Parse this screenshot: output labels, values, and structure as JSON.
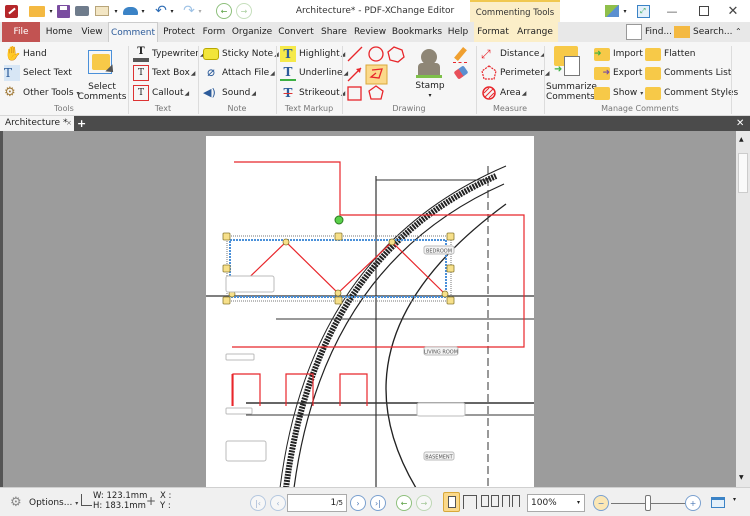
{
  "window": {
    "title": "Architecture* - PDF-XChange Editor",
    "context_tab": "Commenting Tools"
  },
  "menu": {
    "file": "File",
    "items": [
      "Home",
      "View",
      "Comment",
      "Protect",
      "Form",
      "Organize",
      "Convert",
      "Share",
      "Review",
      "Bookmarks",
      "Help"
    ],
    "context_items": [
      "Format",
      "Arrange"
    ],
    "find": "Find...",
    "search": "Search..."
  },
  "ribbon": {
    "tools": {
      "label": "Tools",
      "hand": "Hand",
      "select_text": "Select Text",
      "other_tools": "Other Tools"
    },
    "select_comments": {
      "line1": "Select",
      "line2": "Comments"
    },
    "text": {
      "label": "Text",
      "typewriter": "Typewriter",
      "text_box": "Text Box",
      "callout": "Callout"
    },
    "note": {
      "label": "Note",
      "sticky_note": "Sticky Note",
      "attach_file": "Attach File",
      "sound": "Sound"
    },
    "markup": {
      "label": "Text Markup",
      "highlight": "Highlight",
      "underline": "Underline",
      "strikeout": "Strikeout"
    },
    "drawing": {
      "label": "Drawing",
      "stamp": "Stamp"
    },
    "measure": {
      "label": "Measure",
      "distance": "Distance",
      "perimeter": "Perimeter",
      "area": "Area"
    },
    "summarize": {
      "line1": "Summarize",
      "line2": "Comments"
    },
    "manage": {
      "label": "Manage Comments",
      "import": "Import",
      "export": "Export",
      "show": "Show",
      "flatten": "Flatten",
      "comments_list": "Comments List",
      "comment_styles": "Comment Styles"
    }
  },
  "document_tab": {
    "name": "Architecture *"
  },
  "drawing_labels": {
    "bedroom": "BEDROOM",
    "living_room": "LIVING ROOM",
    "basement": "BASEMENT"
  },
  "statusbar": {
    "options": "Options...",
    "width": "W: 123.1mm",
    "height": "H: 183.1mm",
    "x": "X :",
    "y": "Y :",
    "page_current": "1",
    "page_total": "/5",
    "zoom": "100%"
  },
  "colors": {
    "file_tab": "#c25352",
    "accent": "#2c5b9a",
    "context_tab": "#fbeec8",
    "annotation_red": "#e8262b",
    "selection_blue": "#4a90d9",
    "handle_yellow": "#f7e08a"
  }
}
